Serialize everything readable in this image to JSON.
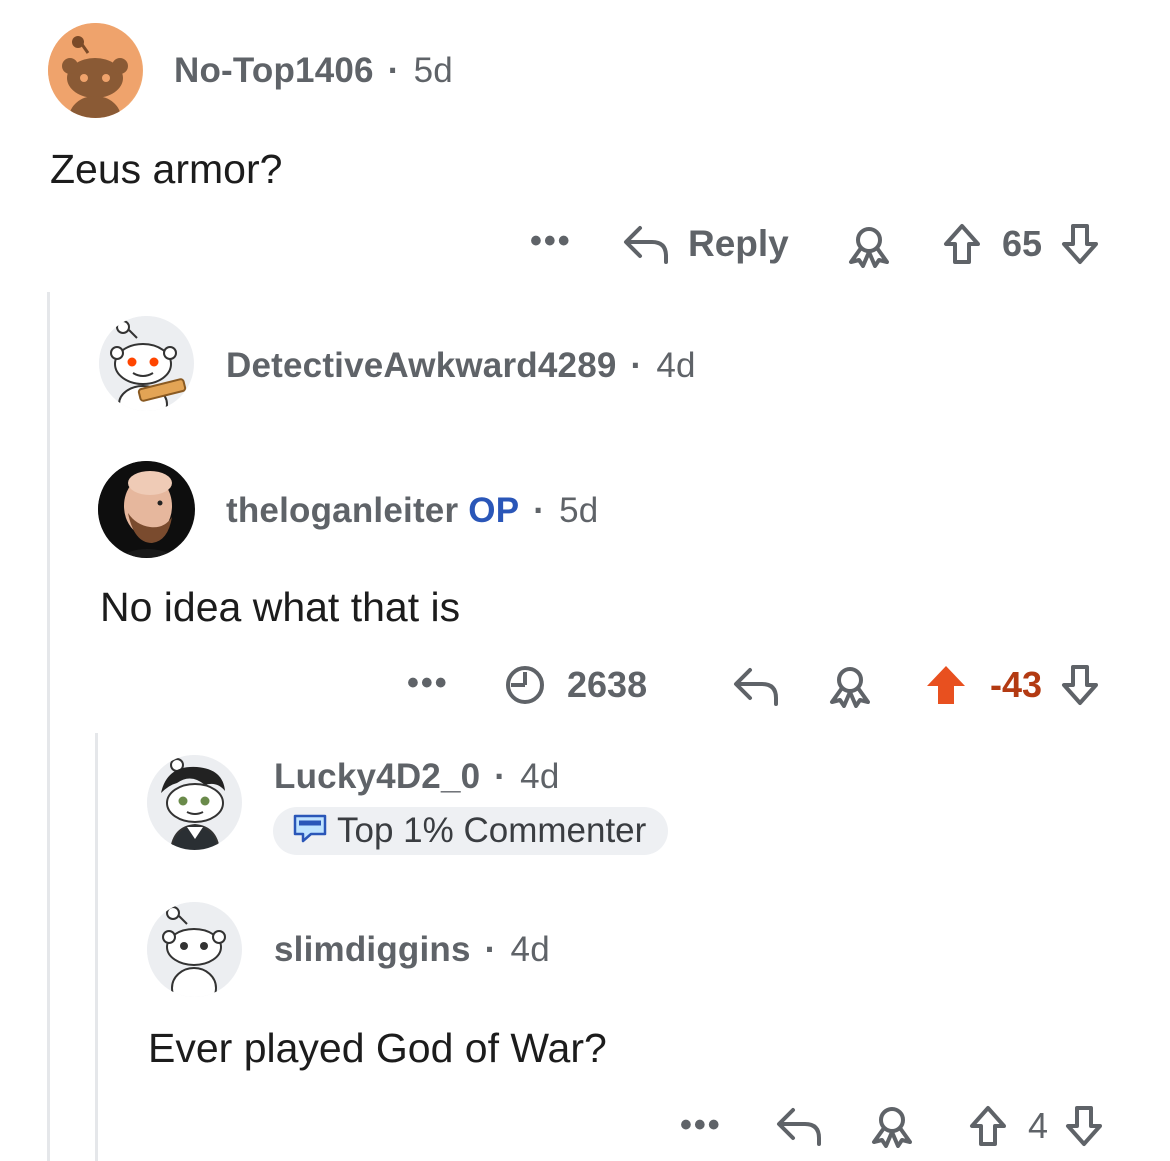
{
  "comments": [
    {
      "username": "No-Top1406",
      "age": "5d",
      "text": "Zeus armor?",
      "reply_label": "Reply",
      "votes": "65"
    },
    {
      "username": "DetectiveAwkward4289",
      "age": "4d"
    },
    {
      "username": "theloganleiter",
      "op_label": "OP",
      "age": "5d",
      "text": "No idea what that is",
      "views": "2638",
      "votes": "-43",
      "upvoted": true
    },
    {
      "username": "Lucky4D2_0",
      "age": "4d",
      "badge": "Top 1% Commenter"
    },
    {
      "username": "slimdiggins",
      "age": "4d",
      "text": "Ever played God of War?",
      "votes": "4"
    }
  ],
  "colors": {
    "upvote_active": "#e8501f",
    "negative_score": "#b33a12",
    "op": "#2a56b8",
    "meta": "#5f6368"
  }
}
